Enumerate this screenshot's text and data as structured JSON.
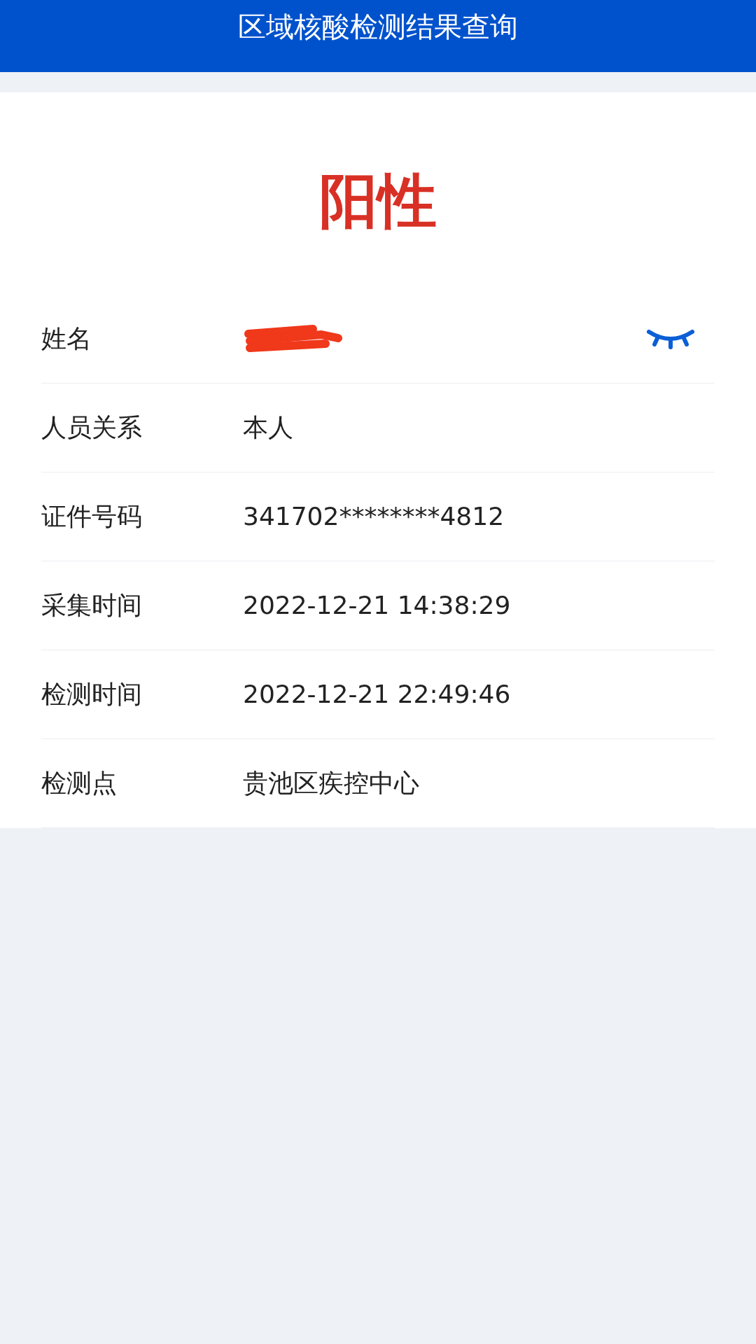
{
  "header": {
    "title": "区域核酸检测结果查询"
  },
  "result": {
    "text": "阳性"
  },
  "rows": [
    {
      "kind": "masked",
      "label": "姓名"
    },
    {
      "kind": "text",
      "label": "人员关系",
      "value": "本人"
    },
    {
      "kind": "text",
      "label": "证件号码",
      "value": "341702********4812"
    },
    {
      "kind": "text",
      "label": "采集时间",
      "value": "2022-12-21 14:38:29"
    },
    {
      "kind": "text",
      "label": "检测时间",
      "value": "2022-12-21 22:49:46"
    },
    {
      "kind": "text",
      "label": "检测点",
      "value": "贵池区疾控中心"
    }
  ]
}
